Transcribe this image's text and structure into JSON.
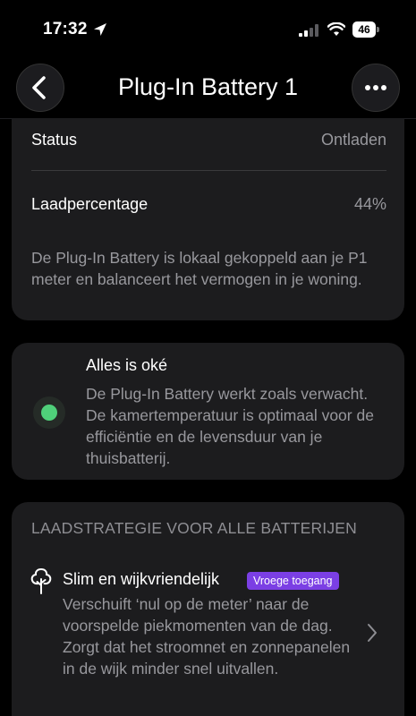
{
  "status_bar": {
    "time": "17:32",
    "battery_level": "46"
  },
  "nav": {
    "title": "Plug-In Battery 1"
  },
  "details": {
    "status_label": "Status",
    "status_value": "Ontladen",
    "charge_label": "Laadpercentage",
    "charge_value": "44%",
    "description": "De Plug-In Battery is lokaal gekoppeld aan je P1 meter en balanceert het vermogen in je woning."
  },
  "health": {
    "title": "Alles is oké",
    "text": "De Plug-In Battery werkt zoals verwacht. De kamertemperatuur is optimaal voor de efficiëntie en de levensduur van je thuisbatterij.",
    "status_color": "#4fd07a"
  },
  "strategy": {
    "header": "LAADSTRATEGIE VOOR ALLE BATTERIJEN",
    "title": "Slim en wijkvriendelijk",
    "badge": "Vroege toegang",
    "badge_color": "#7b3fe4",
    "description": "Verschuift ‘nul op de meter’ naar de voorspelde piekmomenten van de dag. Zorgt dat het stroomnet en zonnepanelen in de wijk minder snel uitvallen."
  }
}
